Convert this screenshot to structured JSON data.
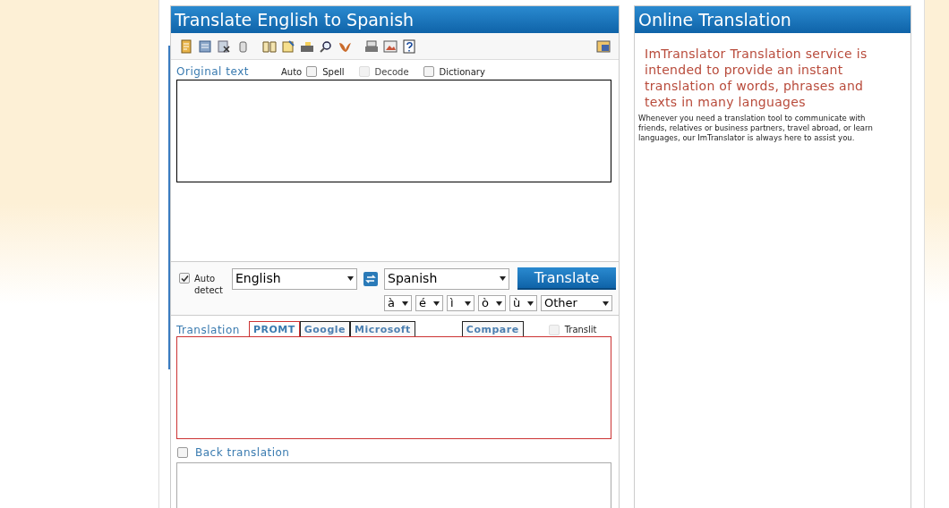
{
  "translator": {
    "title": "Translate English to Spanish",
    "original": {
      "label": "Original text",
      "auto_label": "Auto",
      "options": [
        {
          "label": "Spell",
          "checked": false,
          "disabled": false
        },
        {
          "label": "Decode",
          "checked": false,
          "disabled": true
        },
        {
          "label": "Dictionary",
          "checked": false,
          "disabled": false
        }
      ]
    },
    "auto_detect": {
      "label": "Auto detect",
      "checked": true
    },
    "source_language": "English",
    "target_language": "Spanish",
    "translate_button": "Translate",
    "accents": [
      "à",
      "é",
      "ì",
      "ò",
      "ù",
      "Other"
    ],
    "translation": {
      "label": "Translation",
      "tabs": [
        {
          "label": "PROMT",
          "selected": true
        },
        {
          "label": "Google",
          "selected": false
        },
        {
          "label": "Microsoft",
          "selected": false
        }
      ],
      "compare_tab": {
        "label": "Compare",
        "selected": false
      },
      "translit": {
        "label": "Translit",
        "checked": false,
        "disabled": true
      }
    },
    "back_translation": {
      "label": "Back translation",
      "checked": false
    }
  },
  "info": {
    "title": "Online Translation",
    "headline": "ImTranslator Translation service is intended to provide an instant translation of words, phrases and texts in many languages",
    "body": "Whenever you need a translation tool to communicate with friends, relatives or business partners, travel abroad, or learn languages, our ImTranslator is always here to assist you."
  }
}
